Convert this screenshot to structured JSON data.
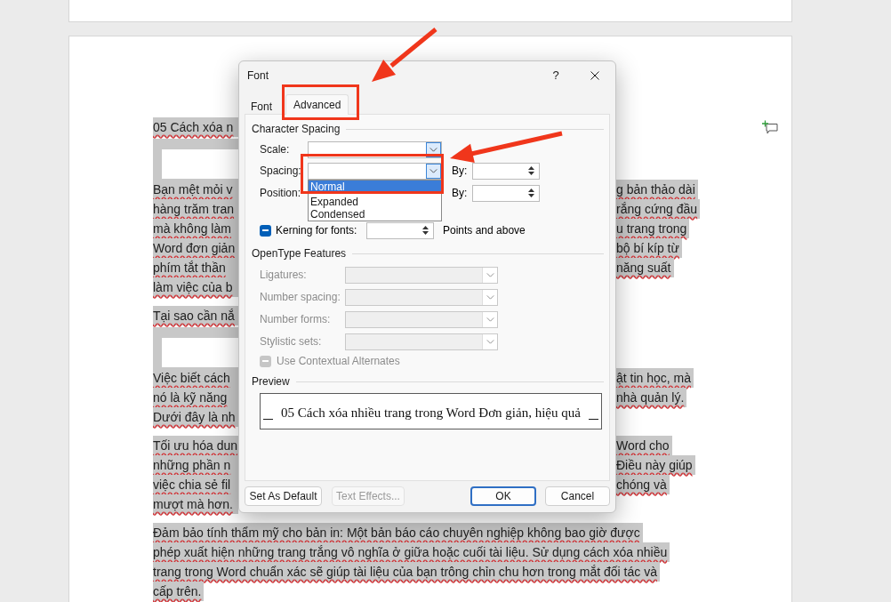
{
  "document": {
    "selected": true,
    "spellcheck_underline": true,
    "paragraphs": [
      {
        "kind": "split",
        "lines": [
          {
            "left": "05 Cách xóa n"
          }
        ]
      },
      {
        "kind": "image"
      },
      {
        "kind": "split",
        "lines": [
          {
            "left": "Bạn mệt mỏi v",
            "right": "g bản thảo dài"
          },
          {
            "left": "hàng trăm tran",
            "right": "rắng cứng đầu"
          },
          {
            "left": "mà không làm",
            "right": "u trang trong"
          },
          {
            "left": "Word đơn giản",
            "right": "bộ bí kíp từ"
          },
          {
            "left": "phím tắt thần",
            "right": "năng suất"
          },
          {
            "left": "làm việc của b"
          }
        ]
      },
      {
        "kind": "split",
        "lines": [
          {
            "left": "Tại sao cần nắ"
          }
        ]
      },
      {
        "kind": "image"
      },
      {
        "kind": "split",
        "lines": [
          {
            "left": "Việc biết cách",
            "right": "ật tin học, mà"
          },
          {
            "left": "nó là kỹ năng",
            "right": "nhà quản lý."
          },
          {
            "left": "Dưới đây là nh"
          }
        ]
      },
      {
        "kind": "split",
        "lines": [
          {
            "left": "Tối ưu hóa dun",
            "right": "Word cho"
          },
          {
            "left": "những phần n",
            "right": "Điều này giúp"
          },
          {
            "left": "việc chia sẻ fil",
            "right": "chóng và"
          },
          {
            "left": "mượt mà hơn."
          }
        ]
      },
      {
        "kind": "full",
        "lines": [
          "Đảm bảo tính thẩm mỹ cho bản in: Một bản báo cáo chuyên nghiệp không bao giờ được",
          "phép xuất hiện những trang trắng vô nghĩa ở giữa hoặc cuối tài liệu. Sử dụng cách xóa nhiều",
          "trang trong Word chuẩn xác sẽ giúp tài liệu của bạn trông chỉn chu hơn trong mắt đối tác và",
          "cấp trên."
        ]
      }
    ]
  },
  "dialog": {
    "title": "Font",
    "help": "?",
    "tabs": [
      {
        "label": "Font",
        "selected": false
      },
      {
        "label": "Advanced",
        "selected": true
      }
    ],
    "character_spacing": {
      "title": "Character Spacing",
      "rows": [
        {
          "kind": "dropdown",
          "label": "Scale:",
          "focused": true
        },
        {
          "kind": "dropdown_by",
          "label": "Spacing:",
          "by": "By:",
          "open": true,
          "options": [
            {
              "label": "Normal",
              "selected": true
            },
            {
              "label": "Expanded",
              "selected": false
            },
            {
              "label": "Condensed",
              "selected": false
            }
          ]
        },
        {
          "kind": "by_only",
          "label": "Position:",
          "by": "By:"
        },
        {
          "kind": "kerning",
          "label": "Kerning for fonts:",
          "indeterminate": true,
          "suffix": "Points and above"
        }
      ]
    },
    "opentype": {
      "title": "OpenType Features",
      "rows": [
        {
          "kind": "dropdown",
          "label": "Ligatures:",
          "disabled": true
        },
        {
          "kind": "dropdown",
          "label": "Number spacing:",
          "disabled": true
        },
        {
          "kind": "dropdown",
          "label": "Number forms:",
          "disabled": true
        },
        {
          "kind": "dropdown",
          "label": "Stylistic sets:",
          "disabled": true
        },
        {
          "kind": "checkbox",
          "label": "Use Contextual Alternates",
          "disabled": true,
          "indeterminate": true
        }
      ]
    },
    "preview": {
      "title": "Preview",
      "text": "05 Cách xóa nhiều trang trong Word Đơn giản, hiệu quả"
    },
    "buttons": [
      {
        "label": "Set As Default",
        "default": false,
        "disabled": false
      },
      {
        "label": "Text Effects...",
        "default": false,
        "disabled": true
      },
      {
        "label": "OK",
        "default": true,
        "disabled": false
      },
      {
        "label": "Cancel",
        "default": false,
        "disabled": false
      }
    ]
  }
}
